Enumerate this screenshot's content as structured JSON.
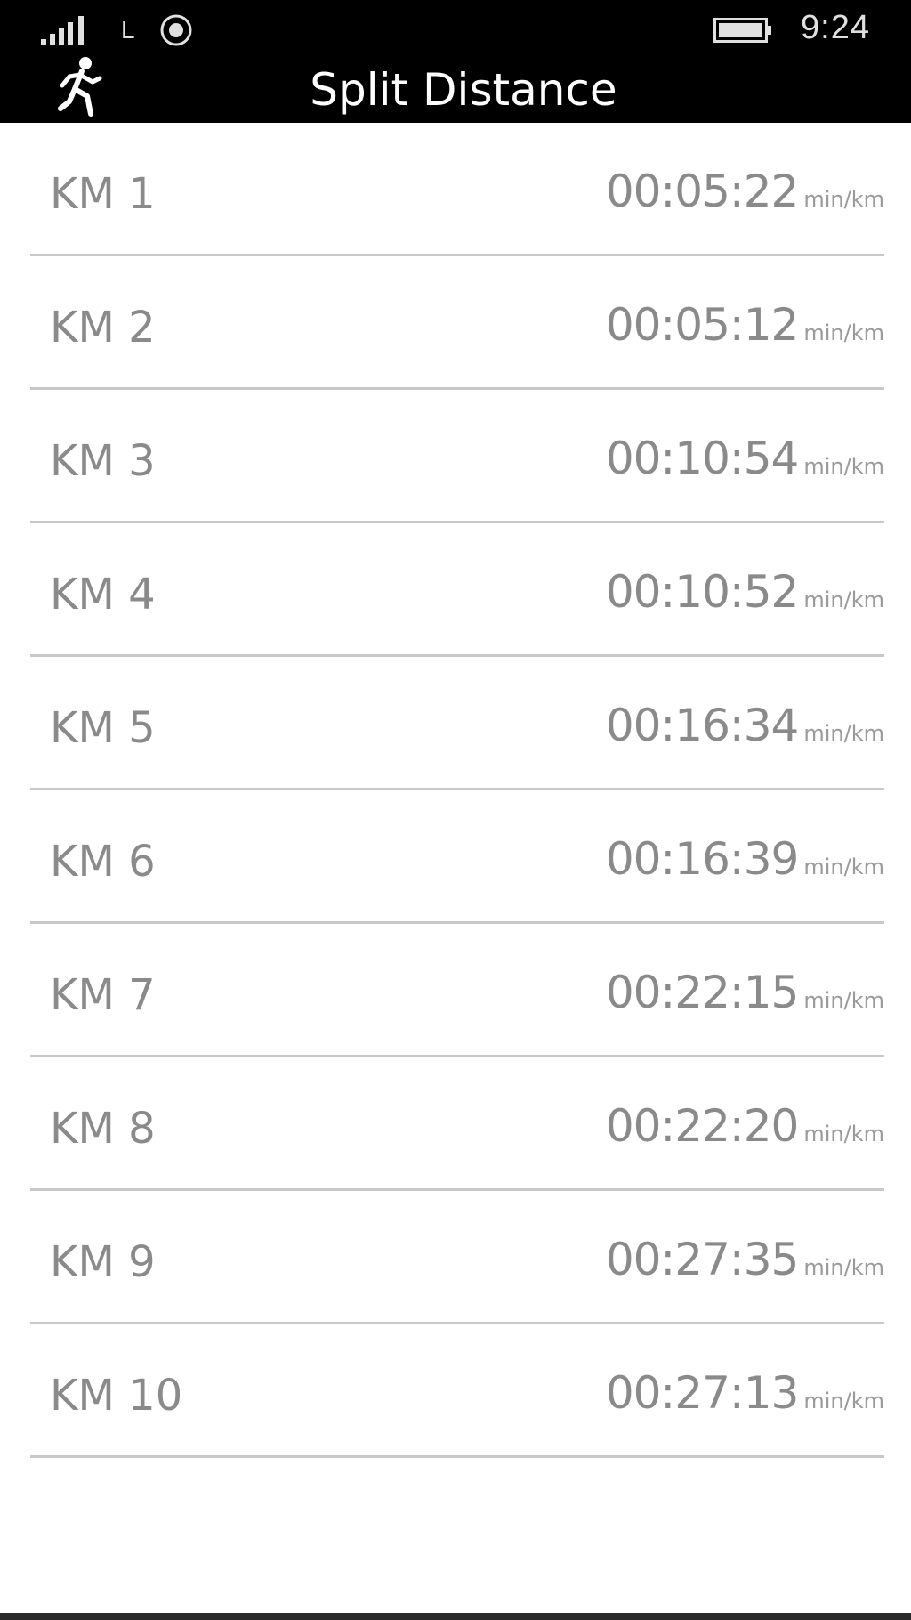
{
  "status_bar": {
    "network": "L",
    "time": "9:24"
  },
  "header": {
    "title": "Split Distance",
    "icon": "runner-icon"
  },
  "splits": [
    {
      "label": "KM 1",
      "time": "00:05:22",
      "unit": "min/km"
    },
    {
      "label": "KM 2",
      "time": "00:05:12",
      "unit": "min/km"
    },
    {
      "label": "KM 3",
      "time": "00:10:54",
      "unit": "min/km"
    },
    {
      "label": "KM 4",
      "time": "00:10:52",
      "unit": "min/km"
    },
    {
      "label": "KM 5",
      "time": "00:16:34",
      "unit": "min/km"
    },
    {
      "label": "KM 6",
      "time": "00:16:39",
      "unit": "min/km"
    },
    {
      "label": "KM 7",
      "time": "00:22:15",
      "unit": "min/km"
    },
    {
      "label": "KM 8",
      "time": "00:22:20",
      "unit": "min/km"
    },
    {
      "label": "KM 9",
      "time": "00:27:35",
      "unit": "min/km"
    },
    {
      "label": "KM 10",
      "time": "00:27:13",
      "unit": "min/km"
    }
  ]
}
